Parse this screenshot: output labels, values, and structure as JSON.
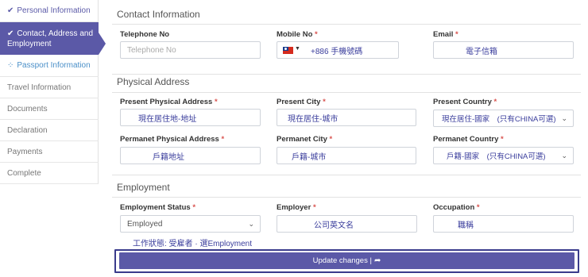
{
  "sidebar": {
    "items": [
      {
        "label": "Personal Information",
        "icon": "check-icon"
      },
      {
        "label": "Contact, Address and Employment",
        "icon": "check-icon"
      },
      {
        "label": "Passport Information",
        "icon": "spinner-icon"
      },
      {
        "label": "Travel Information"
      },
      {
        "label": "Documents"
      },
      {
        "label": "Declaration"
      },
      {
        "label": "Payments"
      },
      {
        "label": "Complete"
      }
    ]
  },
  "contact": {
    "title": "Contact Information",
    "telephone_label": "Telephone No",
    "telephone_placeholder": "Telephone No",
    "mobile_label": "Mobile No",
    "mobile_value": "+886 手機號碼",
    "email_label": "Email",
    "email_value": "電子信箱"
  },
  "address": {
    "title": "Physical Address",
    "present_address_label": "Present Physical Address",
    "present_address_value": "現在居住地-地址",
    "present_city_label": "Present City",
    "present_city_value": "現在居住-城市",
    "present_country_label": "Present Country",
    "present_country_value": "現在居住-國家　(只有CHINA可選)",
    "permanent_address_label": "Permanet Physical Address",
    "permanent_address_value": "戶籍地址",
    "permanent_city_label": "Permanet City",
    "permanent_city_value": "戶籍-城市",
    "permanent_country_label": "Permanet Country",
    "permanent_country_value": "戶籍-國家　(只有CHINA可選)"
  },
  "employment": {
    "title": "Employment",
    "status_label": "Employment Status",
    "status_value": "Employed",
    "employer_label": "Employer",
    "employer_value": "公司英文名",
    "occupation_label": "Occupation",
    "occupation_value": "職稱",
    "hint": "工作狀態: 受雇者 · 選Employment"
  },
  "required_mark": "*",
  "submit_label": "Update changes |",
  "colors": {
    "accent": "#5b59a7",
    "required": "#d9534f",
    "annotation": "#3a3d9c"
  }
}
